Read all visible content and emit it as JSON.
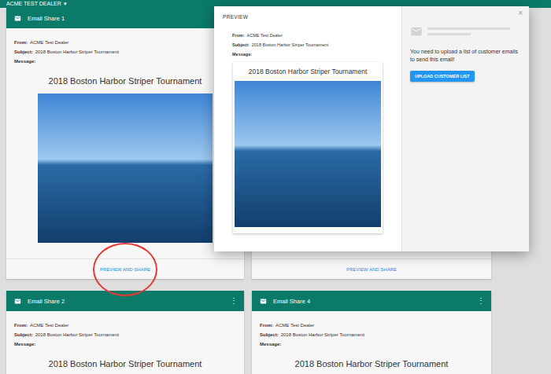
{
  "top_bar": {
    "title": "ACME TEST DEALER",
    "caret": "▾"
  },
  "cards": [
    {
      "title": "Email Share 1",
      "menu": null,
      "meta": [
        {
          "label": "From:",
          "value": "ACME Test Dealer"
        },
        {
          "label": "Subject:",
          "value": "2018 Boston Harbor Striper Tournament"
        },
        {
          "label": "Message:",
          "value": ""
        }
      ],
      "heading": "2018 Boston Harbor Striper Tournament",
      "photo": true,
      "action": "PREVIEW AND SHARE",
      "circled": true
    },
    {
      "title": null,
      "menu": null,
      "meta": [],
      "heading": null,
      "photo": true,
      "action": "PREVIEW AND SHARE",
      "circled": false
    },
    {
      "title": "Email Share 2",
      "menu": "⋮",
      "meta": [
        {
          "label": "From:",
          "value": "ACME Test Dealer"
        },
        {
          "label": "Subject:",
          "value": "2018 Boston Harbor Striper Tournament"
        },
        {
          "label": "Message:",
          "value": ""
        }
      ],
      "heading": "2018 Boston Harbor Striper Tournament",
      "photo": true,
      "action": null,
      "circled": false
    },
    {
      "title": "Email Share 4",
      "menu": "⋮",
      "meta": [
        {
          "label": "From:",
          "value": "ACME Test Dealer"
        },
        {
          "label": "Subject:",
          "value": "2018 Boston Harbor Striper Tournament"
        },
        {
          "label": "Message:",
          "value": ""
        }
      ],
      "heading": "2018 Boston Harbor Striper Tournament",
      "photo": true,
      "action": null,
      "circled": false
    }
  ],
  "modal": {
    "title": "PREVIEW",
    "close": "×",
    "meta": [
      {
        "label": "From:",
        "value": "ACME Test Dealer"
      },
      {
        "label": "Subject:",
        "value": "2018 Boston Harbor Striper Tournament"
      },
      {
        "label": "Message:",
        "value": ""
      }
    ],
    "heading": "2018 Boston Harbor Striper Tournament",
    "photo": true,
    "notice": "You need to upload a list of customer emails to send this email!",
    "button": "UPLOAD CUSTOMER LIST"
  }
}
